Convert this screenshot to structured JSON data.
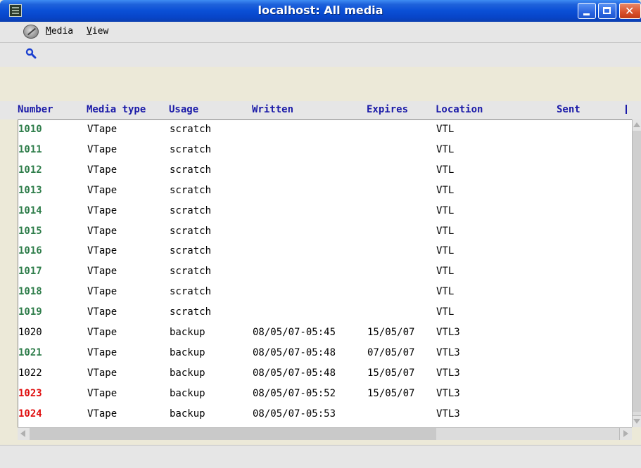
{
  "window": {
    "title": "localhost: All media"
  },
  "menu": {
    "items": [
      {
        "label": "Media",
        "mnemonic": "M"
      },
      {
        "label": "View",
        "mnemonic": "V"
      }
    ]
  },
  "toolbar": {
    "search_icon": "search-icon"
  },
  "table": {
    "columns": [
      "Number",
      "Media type",
      "Usage",
      "Written",
      "Expires",
      "Location",
      "Sent"
    ],
    "rows": [
      {
        "number": "1010",
        "status": "green",
        "type": "VTape",
        "usage": "scratch",
        "written": "",
        "expires": "",
        "location": "VTL"
      },
      {
        "number": "1011",
        "status": "green",
        "type": "VTape",
        "usage": "scratch",
        "written": "",
        "expires": "",
        "location": "VTL"
      },
      {
        "number": "1012",
        "status": "green",
        "type": "VTape",
        "usage": "scratch",
        "written": "",
        "expires": "",
        "location": "VTL"
      },
      {
        "number": "1013",
        "status": "green",
        "type": "VTape",
        "usage": "scratch",
        "written": "",
        "expires": "",
        "location": "VTL"
      },
      {
        "number": "1014",
        "status": "green",
        "type": "VTape",
        "usage": "scratch",
        "written": "",
        "expires": "",
        "location": "VTL"
      },
      {
        "number": "1015",
        "status": "green",
        "type": "VTape",
        "usage": "scratch",
        "written": "",
        "expires": "",
        "location": "VTL"
      },
      {
        "number": "1016",
        "status": "green",
        "type": "VTape",
        "usage": "scratch",
        "written": "",
        "expires": "",
        "location": "VTL"
      },
      {
        "number": "1017",
        "status": "green",
        "type": "VTape",
        "usage": "scratch",
        "written": "",
        "expires": "",
        "location": "VTL"
      },
      {
        "number": "1018",
        "status": "green",
        "type": "VTape",
        "usage": "scratch",
        "written": "",
        "expires": "",
        "location": "VTL"
      },
      {
        "number": "1019",
        "status": "green",
        "type": "VTape",
        "usage": "scratch",
        "written": "",
        "expires": "",
        "location": "VTL"
      },
      {
        "number": "1020",
        "status": "black",
        "type": "VTape",
        "usage": "backup",
        "written": "08/05/07-05:45",
        "expires": "15/05/07",
        "location": "VTL3"
      },
      {
        "number": "1021",
        "status": "green",
        "type": "VTape",
        "usage": "backup",
        "written": "08/05/07-05:48",
        "expires": "07/05/07",
        "location": "VTL3"
      },
      {
        "number": "1022",
        "status": "black",
        "type": "VTape",
        "usage": "backup",
        "written": "08/05/07-05:48",
        "expires": "15/05/07",
        "location": "VTL3"
      },
      {
        "number": "1023",
        "status": "red",
        "type": "VTape",
        "usage": "backup",
        "written": "08/05/07-05:52",
        "expires": "15/05/07",
        "location": "VTL3"
      },
      {
        "number": "1024",
        "status": "red",
        "type": "VTape",
        "usage": "backup",
        "written": "08/05/07-05:53",
        "expires": "",
        "location": "VTL3"
      }
    ]
  },
  "colors": {
    "header_text": "#1a1aa8",
    "green": "#2e7d4a",
    "red": "#e01010",
    "black": "#000000"
  }
}
